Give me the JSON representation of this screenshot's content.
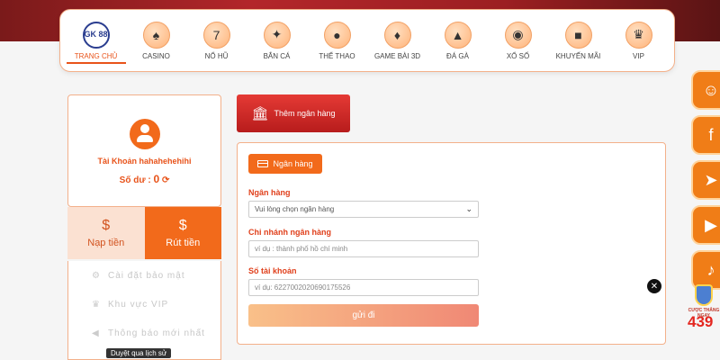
{
  "nav": {
    "items": [
      {
        "label": "TRANG CHỦ",
        "icon": "gk88-logo-icon",
        "logo_text": "GK 88",
        "active": true
      },
      {
        "label": "CASINO",
        "icon": "casino-chip-icon"
      },
      {
        "label": "NỔ HŨ",
        "icon": "slot-machine-icon"
      },
      {
        "label": "BẮN CÁ",
        "icon": "fish-icon"
      },
      {
        "label": "THỂ THAO",
        "icon": "soccer-ball-icon"
      },
      {
        "label": "GAME BÀI 3D",
        "icon": "cards-icon"
      },
      {
        "label": "ĐÁ GÀ",
        "icon": "rooster-icon"
      },
      {
        "label": "XỔ SỐ",
        "icon": "lottery-ball-icon"
      },
      {
        "label": "KHUYẾN MÃI",
        "icon": "gift-icon"
      },
      {
        "label": "VIP",
        "icon": "vip-crown-icon"
      }
    ]
  },
  "account": {
    "label": "Tài Khoản",
    "username": "hahahehehihi",
    "balance_label": "Số dư :",
    "balance_value": "0"
  },
  "actions": {
    "deposit": "Nạp tiền",
    "withdraw": "Rút tiền"
  },
  "menu": {
    "items": [
      {
        "label": "Cài đặt bảo mật",
        "icon": "user-shield-icon"
      },
      {
        "label": "Khu vực VIP",
        "icon": "vip-icon"
      },
      {
        "label": "Thông báo mới nhất",
        "icon": "megaphone-icon"
      }
    ]
  },
  "history_tip": "Duyệt qua lịch sử",
  "add_bank": "Thêm ngân hàng",
  "form": {
    "tab": "Ngân hàng",
    "bank_label": "Ngân hàng",
    "bank_select": "Vui lòng chọn ngân hàng",
    "branch_label": "Chi nhánh ngân hàng",
    "branch_placeholder": "ví dụ : thành phố hồ chí minh",
    "account_label": "Số tài khoản",
    "account_placeholder": "ví dụ:  6227002020690175526",
    "submit": "gửi đi"
  },
  "promo": {
    "small_text": "CƯỢC THẮNG NGAY",
    "number": "439"
  },
  "colors": {
    "accent": "#f26a1b",
    "label_red": "#e0401c",
    "add_bank_red": "#d32f2f"
  }
}
